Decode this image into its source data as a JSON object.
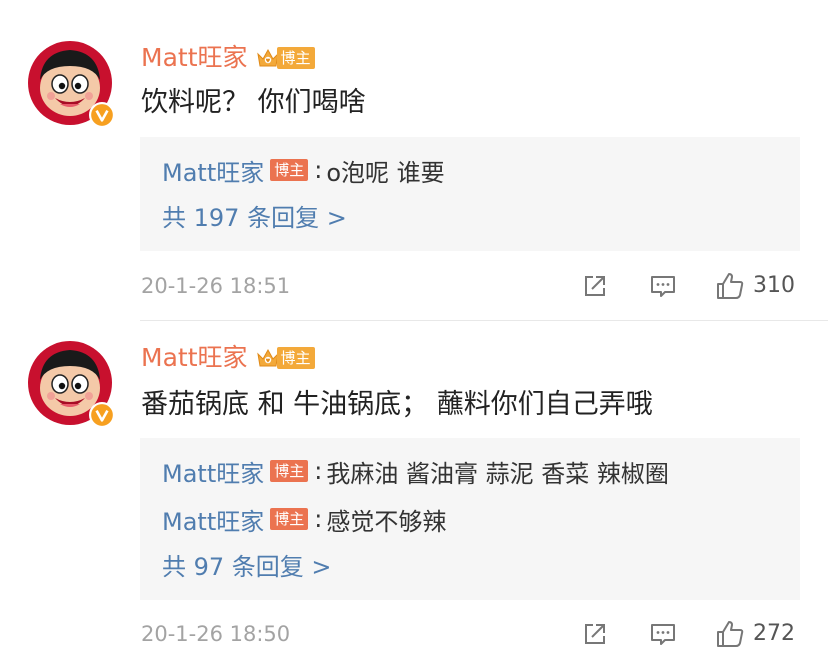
{
  "comments": [
    {
      "author": "Matt旺家",
      "badge": "博主",
      "text": "饮料呢？ 你们喝啥",
      "replies": [
        {
          "author": "Matt旺家",
          "badge": "博主",
          "colon": ":",
          "text": "o泡呢 谁要"
        }
      ],
      "more_replies": "共 197 条回复 >",
      "timestamp": "20-1-26 18:51",
      "likes": "310"
    },
    {
      "author": "Matt旺家",
      "badge": "博主",
      "text": "番茄锅底 和 牛油锅底；  蘸料你们自己弄哦",
      "replies": [
        {
          "author": "Matt旺家",
          "badge": "博主",
          "colon": ":",
          "text": "我麻油 酱油膏 蒜泥 香菜 辣椒圈"
        },
        {
          "author": "Matt旺家",
          "badge": "博主",
          "colon": ":",
          "text": "感觉不够辣"
        }
      ],
      "more_replies": "共 97 条回复 >",
      "timestamp": "20-1-26 18:50",
      "likes": "272"
    }
  ],
  "icons": {
    "share": "share-icon",
    "comment": "comment-icon",
    "like": "thumbs-up-icon",
    "avatar": "wangzai-mascot-avatar",
    "verified": "verified-v-icon",
    "crown": "crown-badge-icon"
  },
  "colors": {
    "author_orange": "#eb7350",
    "reply_blue": "#507daf",
    "badge_orange": "#eb7350",
    "reply_bg": "#f6f6f6",
    "meta_gray": "#a3a3a3"
  }
}
